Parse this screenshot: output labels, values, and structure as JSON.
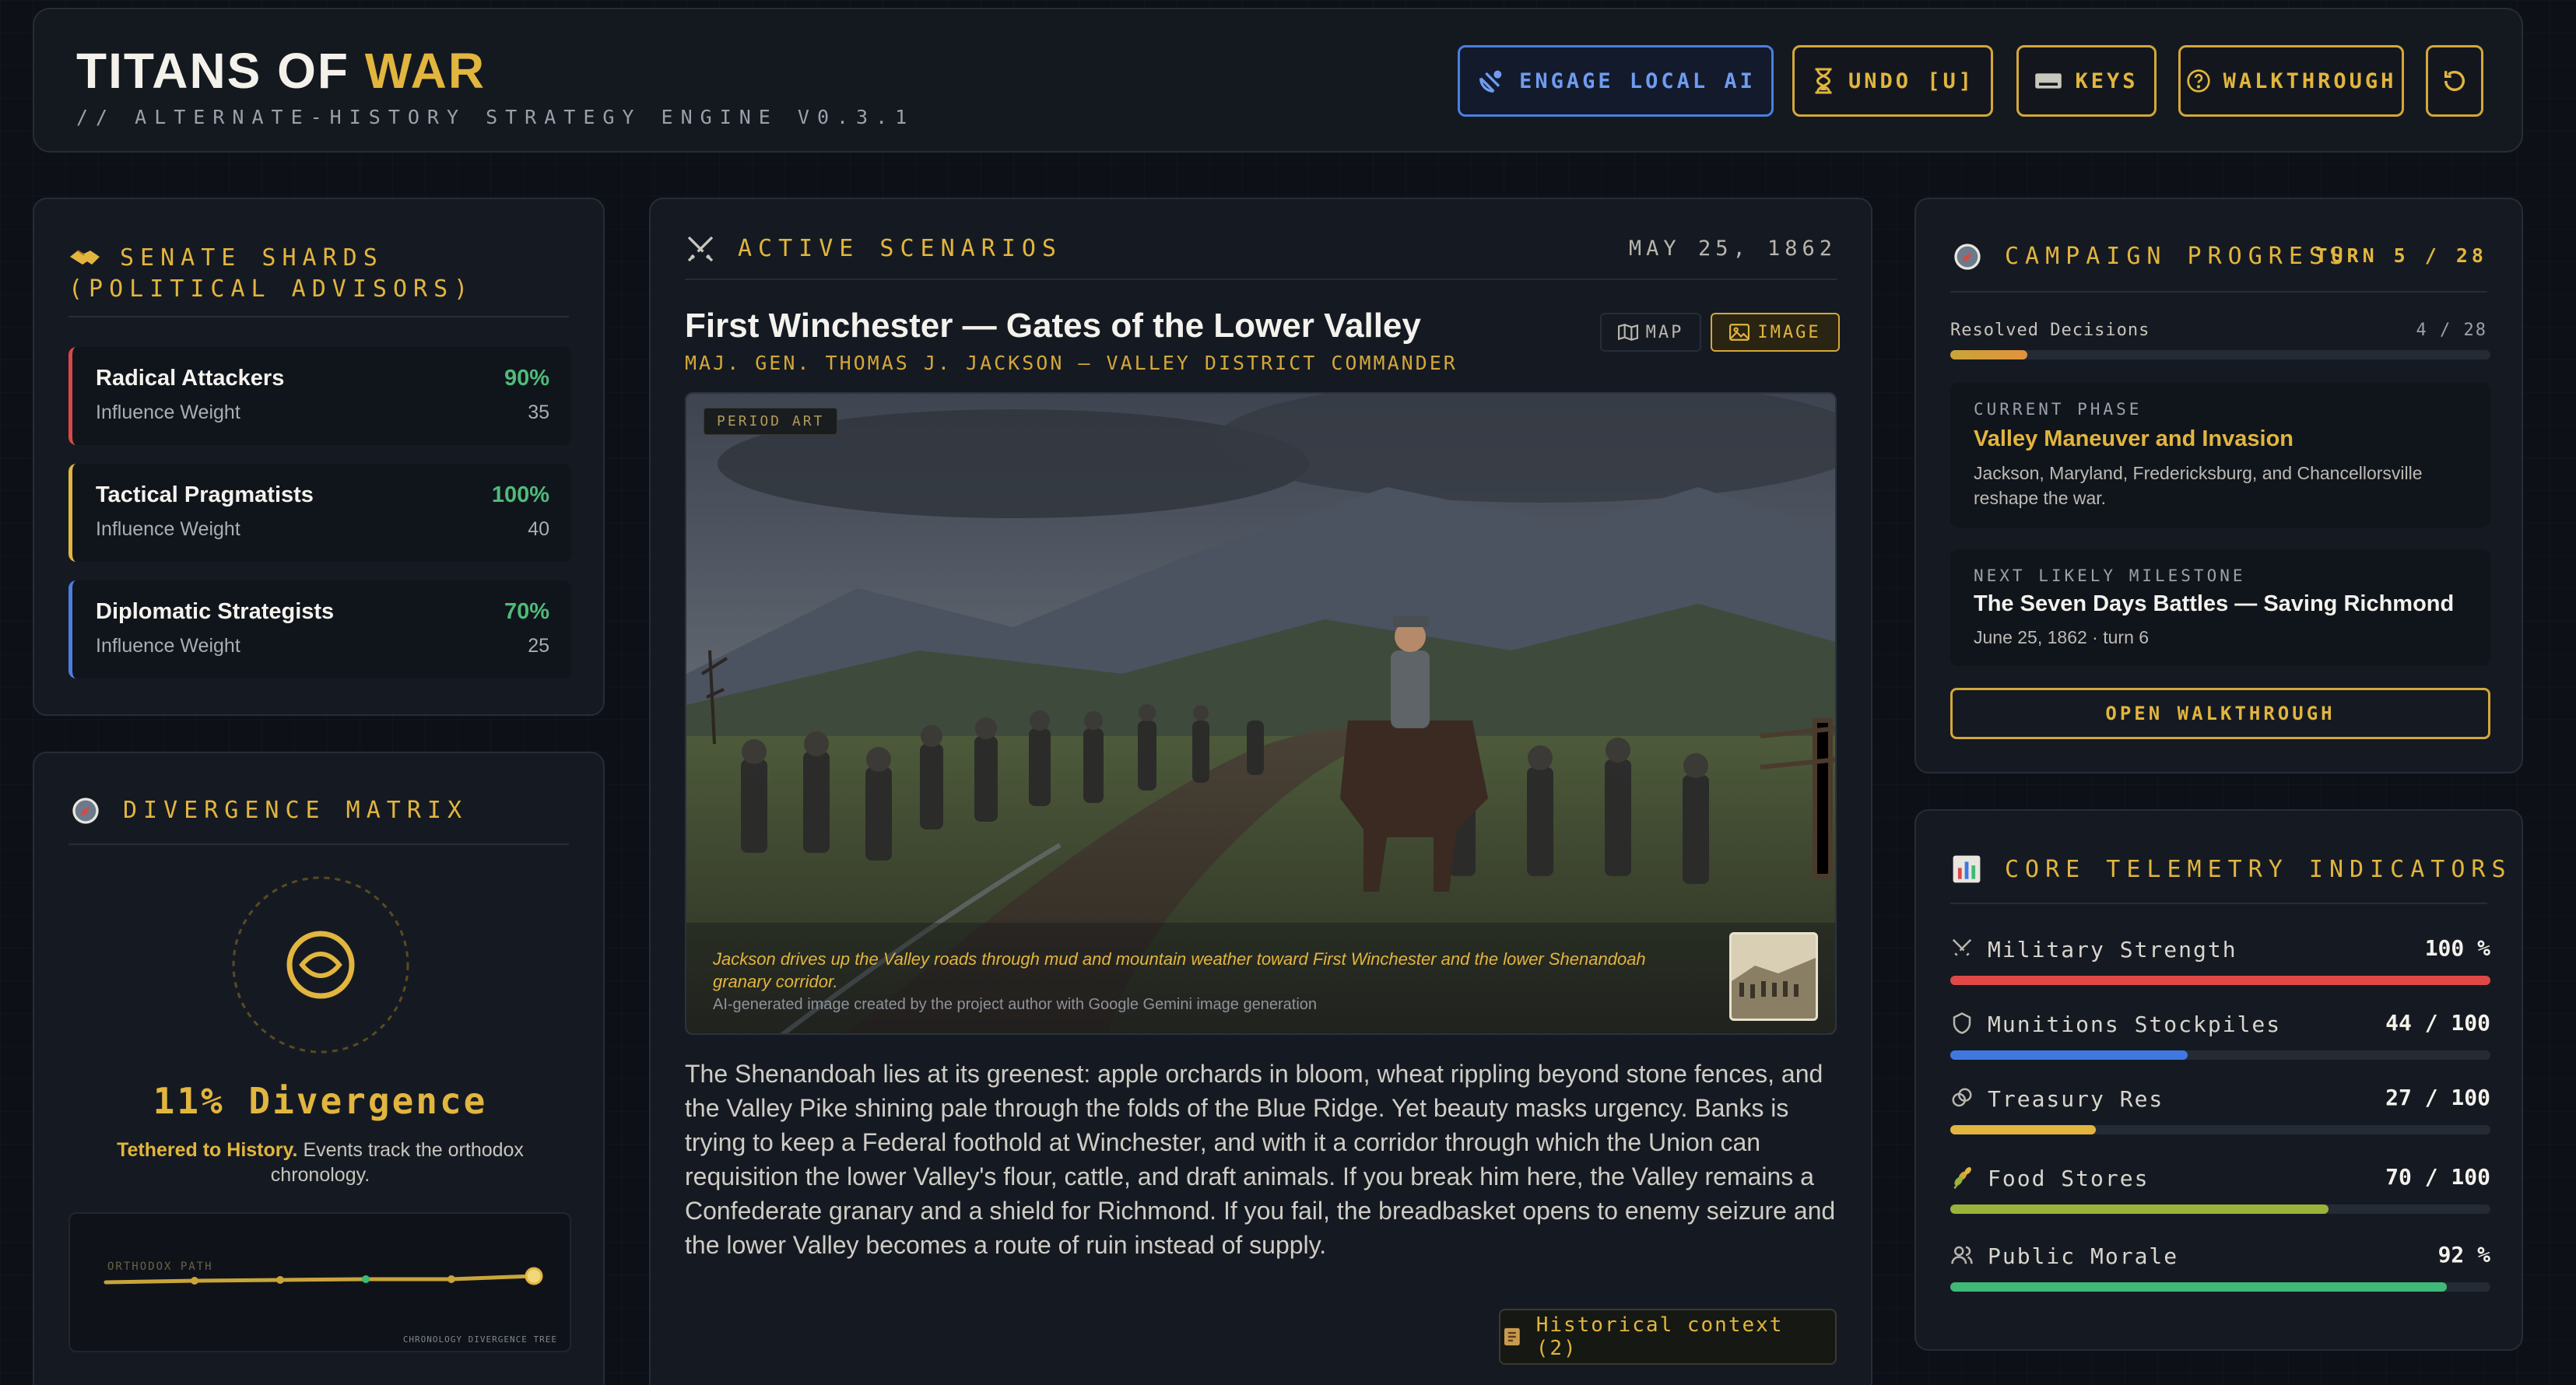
{
  "header": {
    "title_main": "TITANS OF",
    "title_accent": "WAR",
    "subtitle": "// ALTERNATE-HISTORY STRATEGY ENGINE V0.3.1",
    "buttons": {
      "engage_ai": "ENGAGE LOCAL AI",
      "undo": "UNDO [U]",
      "keys": "KEYS",
      "walkthrough": "WALKTHROUGH"
    }
  },
  "senate": {
    "title": "SENATE SHARDS (POLITICAL ADVISORS)",
    "advisors": [
      {
        "name": "Radical Attackers",
        "sub": "Influence Weight",
        "pct": "90%",
        "weight": "35",
        "color": "#d94848"
      },
      {
        "name": "Tactical Pragmatists",
        "sub": "Influence Weight",
        "pct": "100%",
        "weight": "40",
        "color": "#e2b53e"
      },
      {
        "name": "Diplomatic Strategists",
        "sub": "Influence Weight",
        "pct": "70%",
        "weight": "25",
        "color": "#4a7fe0"
      }
    ]
  },
  "divergence": {
    "title": "DIVERGENCE MATRIX",
    "value": "11% Divergence",
    "status_bold": "Tethered to History.",
    "status_text": "Events track the orthodox chronology.",
    "chart_label": "ORTHODOX PATH",
    "chart_caption": "CHRONOLOGY DIVERGENCE TREE"
  },
  "scenarios": {
    "title": "ACTIVE SCENARIOS",
    "date": "MAY 25, 1862",
    "scenario_title": "First Winchester — Gates of the Lower Valley",
    "commander": "MAJ. GEN. THOMAS J. JACKSON — VALLEY DISTRICT COMMANDER",
    "toggle_map": "MAP",
    "toggle_image": "IMAGE",
    "image_badge": "PERIOD ART",
    "image_caption": "Jackson drives up the Valley roads through mud and mountain weather toward First Winchester and the lower Shenandoah granary corridor.",
    "image_credit": "AI-generated image created by the project author with Google Gemini image generation",
    "body": "The Shenandoah lies at its greenest: apple orchards in bloom, wheat rippling beyond stone fences, and the Valley Pike shining pale through the folds of the Blue Ridge. Yet beauty masks urgency. Banks is trying to keep a Federal foothold at Winchester, and with it a corridor through which the Union can requisition the lower Valley's flour, cattle, and draft animals. If you break him here, the Valley remains a Confederate granary and a shield for Richmond. If you fail, the breadbasket opens to enemy seizure and the lower Valley becomes a route of ruin instead of supply.",
    "context_button": "Historical context (2)"
  },
  "campaign": {
    "title": "CAMPAIGN PROGRESS",
    "turn": "TURN 5 / 28",
    "resolved_label": "Resolved Decisions",
    "resolved_value": "4 / 28",
    "resolved_fraction": 0.143,
    "phase_label": "CURRENT PHASE",
    "phase_title": "Valley Maneuver and Invasion",
    "phase_desc": "Jackson, Maryland, Fredericksburg, and Chancellorsville reshape the war.",
    "milestone_label": "NEXT LIKELY MILESTONE",
    "milestone_title": "The Seven Days Battles — Saving Richmond",
    "milestone_date": "June 25, 1862 · turn 6",
    "walkthrough_button": "OPEN WALKTHROUGH"
  },
  "telemetry": {
    "title": "CORE TELEMETRY INDICATORS",
    "indicators": [
      {
        "name": "Military Strength",
        "value": "100 %",
        "level": 1.0,
        "color": "#e04848",
        "icon": "swords-icon"
      },
      {
        "name": "Munitions Stockpiles",
        "value": "44 / 100",
        "level": 0.44,
        "color": "#3f78e0",
        "icon": "shield-icon"
      },
      {
        "name": "Treasury Res",
        "value": "27 / 100",
        "level": 0.27,
        "color": "#e2b53e",
        "icon": "coins-icon"
      },
      {
        "name": "Food Stores",
        "value": "70 / 100",
        "level": 0.7,
        "color": "#9bb33a",
        "icon": "wheat-icon"
      },
      {
        "name": "Public Morale",
        "value": "92 %",
        "level": 0.92,
        "color": "#3fb878",
        "icon": "people-icon"
      }
    ]
  }
}
